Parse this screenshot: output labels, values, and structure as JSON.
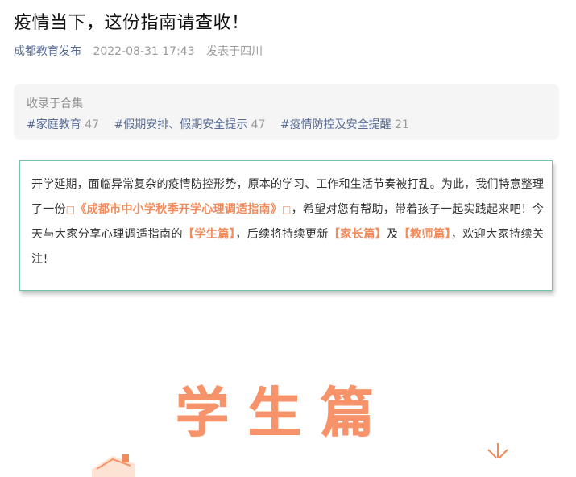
{
  "article": {
    "title": "疫情当下，这份指南请查收！",
    "author": "成都教育发布",
    "datetime": "2022-08-31 17:43",
    "location": "发表于四川"
  },
  "collection": {
    "header": "收录于合集",
    "tags": [
      {
        "name": "#家庭教育",
        "count": "47"
      },
      {
        "name": "#假期安排、假期安全提示",
        "count": "47"
      },
      {
        "name": "#疫情防控及安全提醒",
        "count": "21"
      }
    ]
  },
  "intro": {
    "p1": "开学延期，面临异常复杂的疫情防控形势，原本的学习、工作和生活节奏被打乱。为此，我们特意整理了一份",
    "box_char": "□",
    "guide_title": "《成都市中小学秋季开学心理调适指南》",
    "p2": "，希望对您有帮助，带着孩子一起实践起来吧！今天与大家分享心理调适指南的",
    "student": "【学生篇】",
    "p3": "，后续将持续更新",
    "parent": "【家长篇】",
    "p4": "及",
    "teacher": "【教师篇】",
    "p5": "，欢迎大家持续关注！"
  },
  "banner": {
    "heading": "学生篇"
  },
  "colors": {
    "accent_orange": "#f28a5a",
    "link_blue": "#576b95",
    "border_green": "#73c4a4"
  }
}
